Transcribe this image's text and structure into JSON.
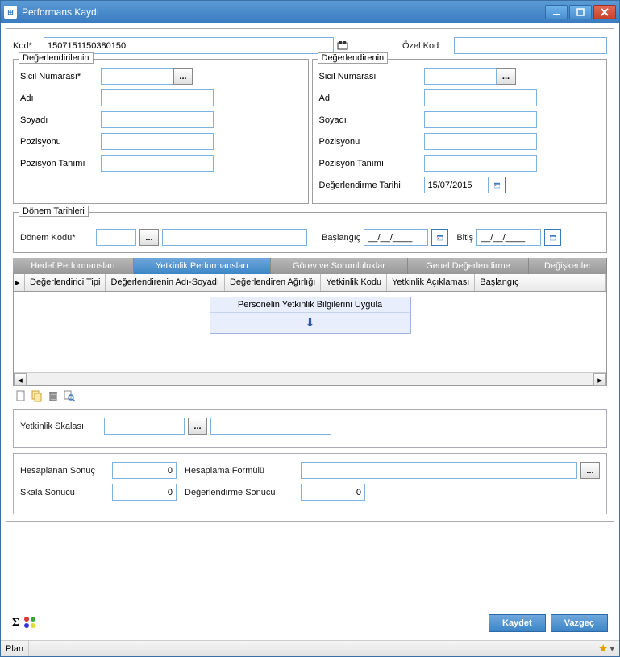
{
  "window": {
    "title": "Performans Kaydı"
  },
  "top": {
    "kod_label": "Kod*",
    "kod_value": "1507151150380150",
    "ozel_kod_label": "Özel Kod",
    "ozel_kod_value": ""
  },
  "degerlendirilenin": {
    "legend": "Değerlendirilenin",
    "sicil_label": "Sicil Numarası*",
    "sicil_value": "",
    "adi_label": "Adı",
    "adi_value": "",
    "soyadi_label": "Soyadı",
    "soyadi_value": "",
    "pozisyonu_label": "Pozisyonu",
    "pozisyonu_value": "",
    "pozisyon_tanimi_label": "Pozisyon Tanımı",
    "pozisyon_tanimi_value": ""
  },
  "degerlendirenin": {
    "legend": "Değerlendirenin",
    "sicil_label": "Sicil Numarası",
    "sicil_value": "",
    "adi_label": "Adı",
    "adi_value": "",
    "soyadi_label": "Soyadı",
    "soyadi_value": "",
    "pozisyonu_label": "Pozisyonu",
    "pozisyonu_value": "",
    "pozisyon_tanimi_label": "Pozisyon Tanımı",
    "pozisyon_tanimi_value": "",
    "tarih_label": "Değerlendirme Tarihi",
    "tarih_value": "15/07/2015"
  },
  "donem": {
    "legend": "Dönem Tarihleri",
    "kod_label": "Dönem Kodu*",
    "kod_value": "",
    "extra_value": "",
    "baslangic_label": "Başlangıç",
    "baslangic_value": "__/__/____",
    "bitis_label": "Bitiş",
    "bitis_value": "__/__/____"
  },
  "tabs": {
    "t0": "Hedef Performansları",
    "t1": "Yetkinlik Performansları",
    "t2": "Görev ve Sorumluluklar",
    "t3": "Genel Değerlendirme",
    "t4": "Değişkenler"
  },
  "grid": {
    "c0": "Değerlendirici Tipi",
    "c1": "Değerlendirenin Adı-Soyadı",
    "c2": "Değerlendiren Ağırlığı",
    "c3": "Yetkinlik Kodu",
    "c4": "Yetkinlik Açıklaması",
    "c5": "Başlangıç",
    "banner": "Personelin Yetkinlik Bilgilerini Uygula"
  },
  "picker_dots": "...",
  "skala": {
    "label": "Yetkinlik Skalası",
    "value1": "",
    "value2": ""
  },
  "sonuc": {
    "hesaplanan_label": "Hesaplanan Sonuç",
    "hesaplanan_value": "0",
    "formul_label": "Hesaplama Formülü",
    "formul_value": "",
    "skala_sonucu_label": "Skala Sonucu",
    "skala_sonucu_value": "0",
    "deg_sonucu_label": "Değerlendirme Sonucu",
    "deg_sonucu_value": "0"
  },
  "footer": {
    "kaydet": "Kaydet",
    "vazgec": "Vazgeç"
  },
  "status": {
    "plan": "Plan"
  }
}
